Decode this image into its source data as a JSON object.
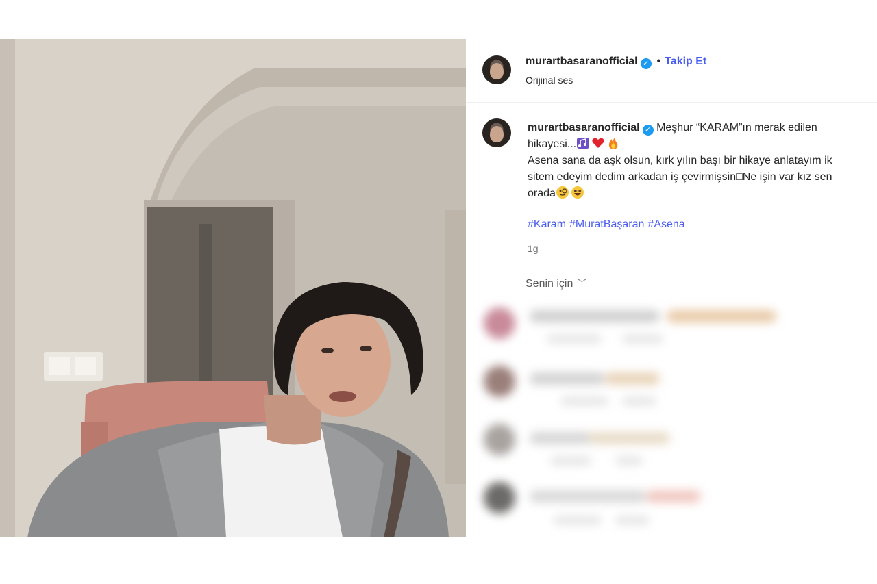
{
  "post": {
    "username": "murartbasaranofficial",
    "follow_label": "Takip Et",
    "dot": "•",
    "audio_label": "Orijinal ses"
  },
  "caption": {
    "username": "murartbasaranofficial",
    "line1": "Meşhur “KARAM”ın merak edilen",
    "line2": "hikayesi...",
    "line3": "Asena sana da aşk olsun, kırk yılın başı bir hikaye anlatayım ik",
    "line4": "sitem edeyim dedim arkadan iş çevirmişsin□Ne işin var kız sen",
    "line5": "orada",
    "hashtags": [
      "#Karam",
      "#MuratBaşaran",
      "#Asena"
    ],
    "time": "1g"
  },
  "comments_filter": {
    "label": "Senin için",
    "chevron": "⌄"
  },
  "icons": {
    "verified": "verified-badge-icon",
    "chevron": "chevron-down-icon"
  },
  "colors": {
    "link": "#4a5df0",
    "verified": "#1d9bf0",
    "secondary": "#737373"
  }
}
